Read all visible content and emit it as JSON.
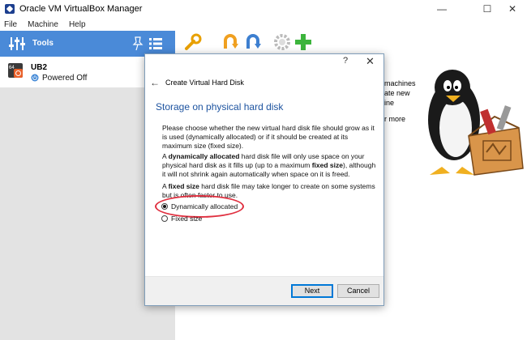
{
  "window": {
    "title": "Oracle VM VirtualBox Manager",
    "minimize": "—",
    "maximize": "☐",
    "close": "✕"
  },
  "menu": [
    "File",
    "Machine",
    "Help"
  ],
  "sidebar": {
    "tools_label": "Tools",
    "vm": {
      "name": "UB2",
      "state": "Powered Off",
      "badge": "64"
    }
  },
  "background": {
    "text_lines": [
      "machines",
      "ate new",
      "ine"
    ],
    "more_link": "r more"
  },
  "dialog": {
    "help": "?",
    "close": "✕",
    "back": "←",
    "title": "Create Virtual Hard Disk",
    "heading": "Storage on physical hard disk",
    "para1": "Please choose whether the new virtual hard disk file should grow as it is used (dynamically allocated) or if it should be created at its maximum size (fixed size).",
    "para2": {
      "a": "A ",
      "b": "dynamically allocated",
      "c": " hard disk file will only use space on your physical hard disk as it fills up (up to a maximum ",
      "d": "fixed size",
      "e": "), although it will not shrink again automatically when space on it is freed."
    },
    "para3": {
      "a": "A ",
      "b": "fixed size",
      "c": " hard disk file may take longer to create on some systems but is often faster to use."
    },
    "options": [
      {
        "label": "Dynamically allocated",
        "checked": true
      },
      {
        "label": "Fixed size",
        "checked": false
      }
    ],
    "next": "Next",
    "cancel": "Cancel"
  },
  "colors": {
    "tools_bar": "#4a8ad8",
    "heading": "#1e54a0",
    "highlight": "#e03040"
  }
}
